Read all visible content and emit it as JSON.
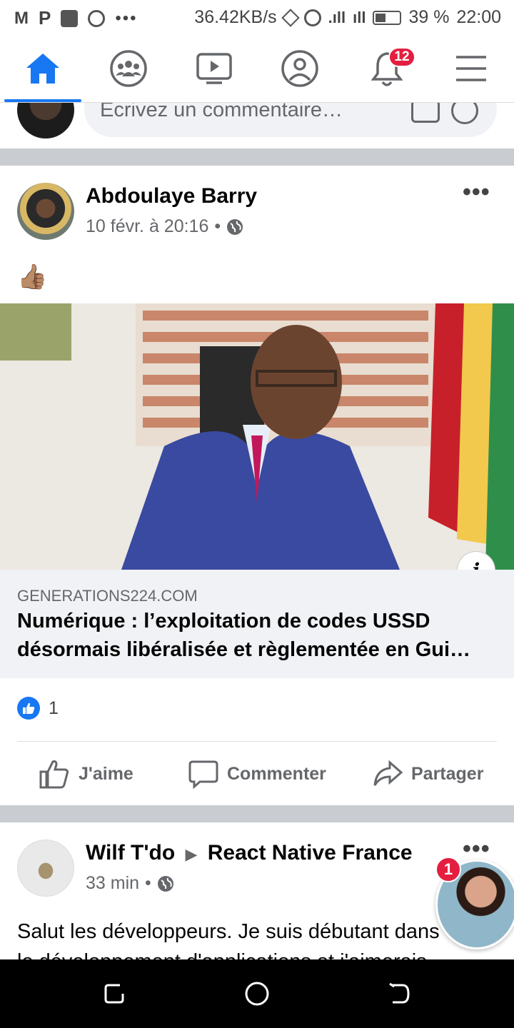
{
  "status_bar": {
    "speed": "36.42KB/s",
    "battery": "39 %",
    "time": "22:00"
  },
  "nav": {
    "items": [
      "home-icon",
      "groups-icon",
      "watch-icon",
      "profile-icon",
      "notifications-icon",
      "menu-icon"
    ],
    "notifications_badge": "12",
    "accent": "#1877f2"
  },
  "comment_box": {
    "placeholder": "Écrivez un commentaire…"
  },
  "post1": {
    "author": "Abdoulaye Barry",
    "timestamp": "10 févr. à 20:16",
    "separator": "•",
    "text": "👍🏽",
    "link": {
      "domain": "GENERATIONS224.COM",
      "title": "Numérique : l’exploitation de codes USSD désormais libéralisée et règlementée en Gui…"
    },
    "like_count": "1",
    "actions": {
      "like": "J'aime",
      "comment": "Commenter",
      "share": "Partager"
    }
  },
  "post2": {
    "author": "Wilf T'do",
    "arrow": "▶",
    "group": "React Native France",
    "timestamp": "33 min",
    "separator": "•",
    "text_line1": "Salut les développeurs. Je suis débutant dans",
    "text_line2": "le développement d'applications et j'aimerais"
  },
  "chat_head": {
    "badge": "1"
  }
}
